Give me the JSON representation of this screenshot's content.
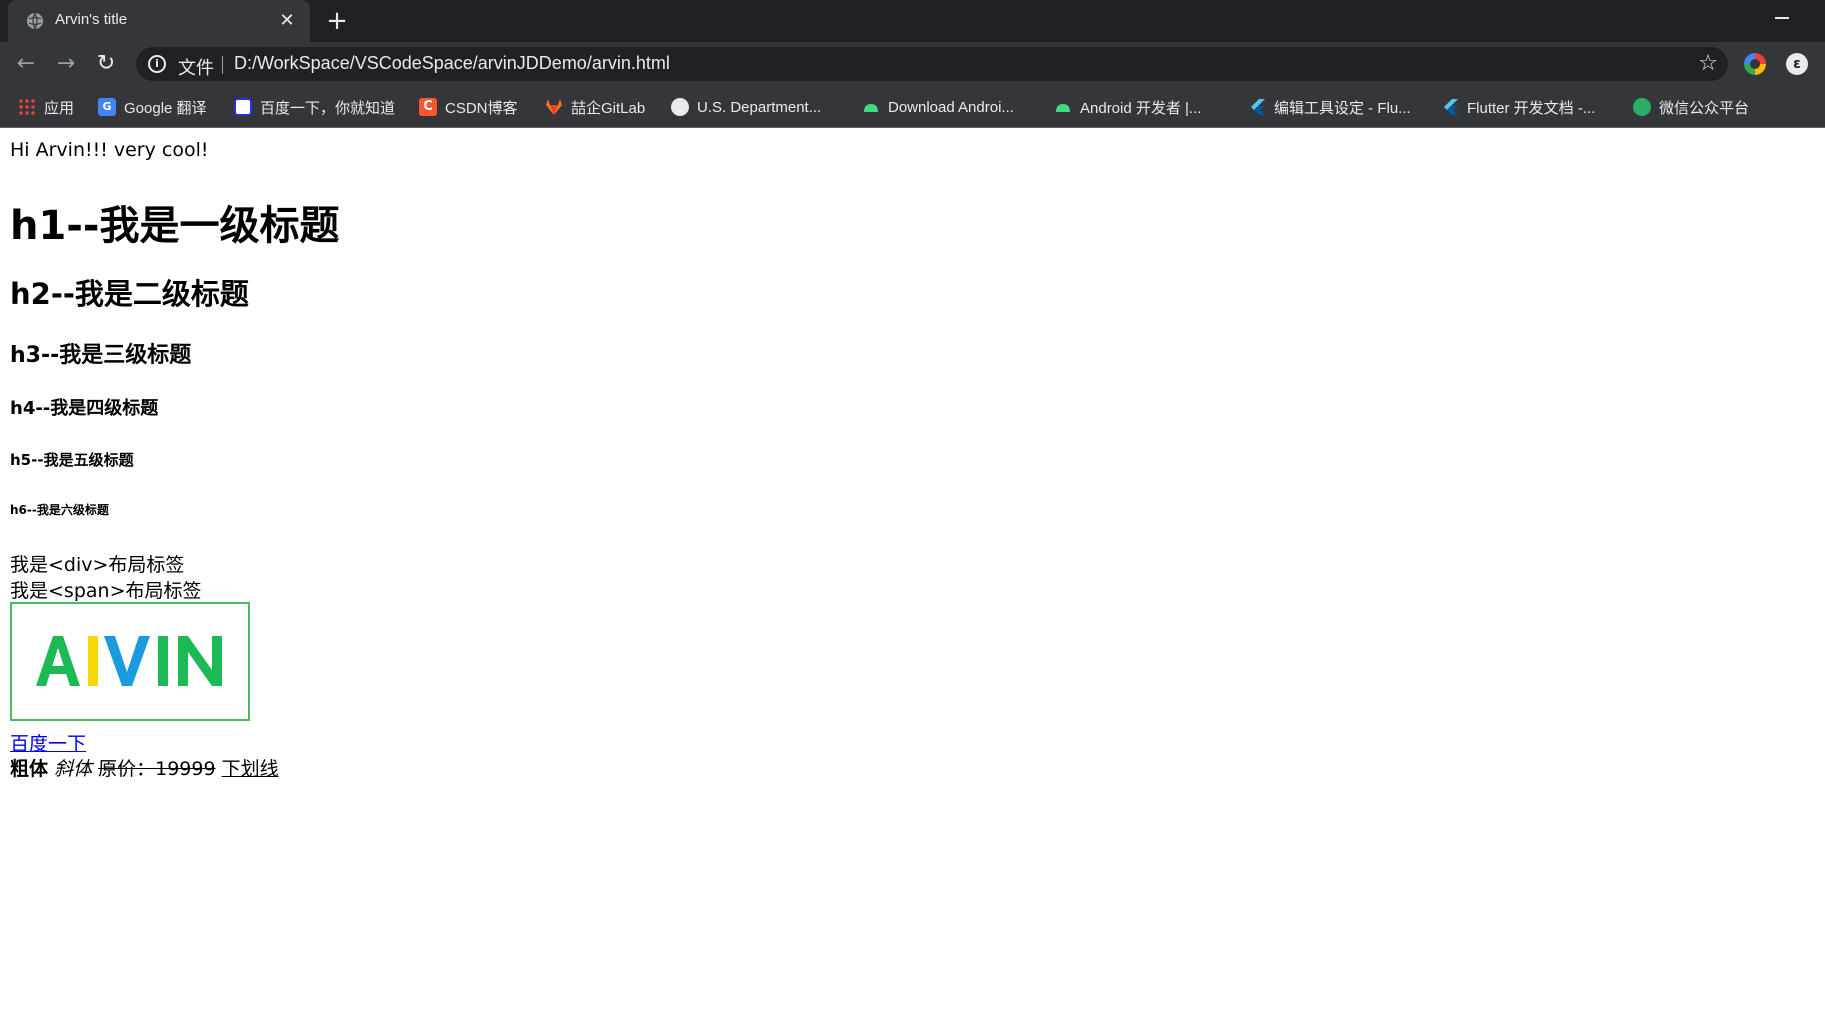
{
  "browser": {
    "tab_title": "Arvin's title",
    "tab_close": "✕",
    "new_tab": "+",
    "scheme_label": "文件",
    "url": "D:/WorkSpace/VSCodeSpace/arvinJDDemo/arvin.html",
    "bookmarks": [
      {
        "label": "应用",
        "icon": "apps-icon"
      },
      {
        "label": "Google 翻译",
        "icon": "google-translate-icon"
      },
      {
        "label": "百度一下，你就知道",
        "icon": "baidu-icon"
      },
      {
        "label": "CSDN博客",
        "icon": "csdn-icon"
      },
      {
        "label": "喆企GitLab",
        "icon": "gitlab-icon"
      },
      {
        "label": "U.S. Department...",
        "icon": "globe-icon"
      },
      {
        "label": "Download Androi...",
        "icon": "android-icon"
      },
      {
        "label": "Android 开发者 |...",
        "icon": "android-icon"
      },
      {
        "label": "编辑工具设定 - Flu...",
        "icon": "flutter-icon"
      },
      {
        "label": "Flutter 开发文档 -...",
        "icon": "flutter-icon"
      },
      {
        "label": "微信公众平台",
        "icon": "wechat-icon"
      }
    ]
  },
  "page": {
    "greeting": "Hi Arvin!!! very cool!",
    "h1": "h1--我是一级标题",
    "h2": "h2--我是二级标题",
    "h3": "h3--我是三级标题",
    "h4": "h4--我是四级标题",
    "h5": "h5--我是五级标题",
    "h6": "h6--我是六级标题",
    "div_text": "我是<div>布局标签",
    "span_text": "我是<span>布局标签",
    "logo_text": "AIVIN",
    "link_text": "百度一下",
    "bold_text": "粗体",
    "italic_text": "斜体",
    "strike_text": "原价：19999",
    "underline_text": "下划线"
  },
  "colors": {
    "chrome_dark": "#202124",
    "chrome_mid": "#35363a",
    "link": "#0000ee",
    "logo_border": "#4cbb5f",
    "logo_green": "#1db954",
    "logo_yellow": "#f5d90a",
    "logo_blue": "#1a9be0"
  }
}
